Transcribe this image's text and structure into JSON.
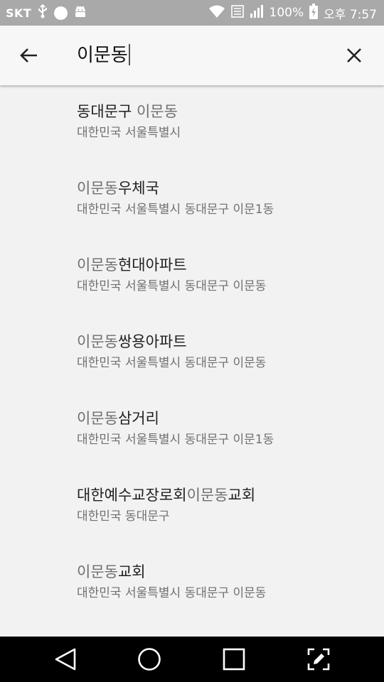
{
  "status_bar": {
    "carrier": "SKT",
    "battery": "100%",
    "time": "오후 7:57",
    "icons": [
      "usb-icon",
      "circle-notification-icon",
      "android-icon",
      "wifi-icon",
      "lte-icon",
      "signal-icon",
      "battery-icon"
    ]
  },
  "search": {
    "query": "이문동",
    "back_icon": "arrow-back-icon",
    "clear_icon": "close-icon"
  },
  "results": [
    {
      "title_parts": [
        {
          "text": "동대문구 ",
          "dim": false
        },
        {
          "text": "이문동",
          "dim": true
        }
      ],
      "subtitle": "대한민국 서울특별시"
    },
    {
      "title_parts": [
        {
          "text": "이문동",
          "dim": true
        },
        {
          "text": "우체국",
          "dim": false
        }
      ],
      "subtitle": "대한민국 서울특별시 동대문구 이문1동"
    },
    {
      "title_parts": [
        {
          "text": "이문동",
          "dim": true
        },
        {
          "text": "현대아파트",
          "dim": false
        }
      ],
      "subtitle": "대한민국 서울특별시 동대문구 이문동"
    },
    {
      "title_parts": [
        {
          "text": "이문동",
          "dim": true
        },
        {
          "text": "쌍용아파트",
          "dim": false
        }
      ],
      "subtitle": "대한민국 서울특별시 동대문구 이문동"
    },
    {
      "title_parts": [
        {
          "text": "이문동",
          "dim": true
        },
        {
          "text": "삼거리",
          "dim": false
        }
      ],
      "subtitle": "대한민국 서울특별시 동대문구 이문1동"
    },
    {
      "title_parts": [
        {
          "text": "대한예수교장로회",
          "dim": false
        },
        {
          "text": "이문동",
          "dim": true
        },
        {
          "text": "교회",
          "dim": false
        }
      ],
      "subtitle": "대한민국 동대문구"
    },
    {
      "title_parts": [
        {
          "text": "이문동",
          "dim": true
        },
        {
          "text": "교회",
          "dim": false
        }
      ],
      "subtitle": "대한민국 서울특별시 동대문구 이문동"
    }
  ],
  "nav_bar": {
    "icons": [
      "back-triangle-icon",
      "home-circle-icon",
      "recents-square-icon",
      "capture-edit-icon"
    ]
  },
  "colors": {
    "status_bar_bg": "#a9a9a9",
    "search_bar_bg": "#f7f7f7",
    "page_bg": "#f2f2f2",
    "nav_bar_bg": "#000000"
  }
}
